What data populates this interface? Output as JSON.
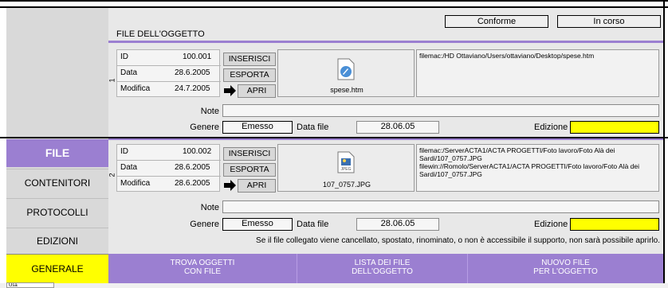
{
  "header": {
    "btn_conforme": "Conforme",
    "btn_in_corso": "In corso",
    "section_title": "FILE DELL'OGGETTO"
  },
  "records": [
    {
      "index": "1",
      "id_label": "ID",
      "id_value": "100.001",
      "data_label": "Data",
      "data_value": "28.6.2005",
      "modifica_label": "Modifica",
      "modifica_value": "24.7.2005",
      "btn_inserisci": "INSERISCI",
      "btn_esporta": "ESPORTA",
      "btn_apri": "APRI",
      "file_name": "spese.htm",
      "path": "filemac:/HD Ottaviano/Users/ottaviano/Desktop/spese.htm",
      "note_label": "Note",
      "note_value": "",
      "genere_label": "Genere",
      "genere_value": "Emesso",
      "data_file_label": "Data file",
      "data_file_value": "28.06.05",
      "edizione_label": "Edizione",
      "edizione_value": ""
    },
    {
      "index": "2",
      "id_label": "ID",
      "id_value": "100.002",
      "data_label": "Data",
      "data_value": "28.6.2005",
      "modifica_label": "Modifica",
      "modifica_value": "28.6.2005",
      "btn_inserisci": "INSERISCI",
      "btn_esporta": "ESPORTA",
      "btn_apri": "APRI",
      "file_name": "107_0757.JPG",
      "thumb_caption": "JPEG",
      "path": "filemac:/ServerACTA1/ACTA PROGETTI/Foto lavoro/Foto Alà dei Sardi/107_0757.JPG\nfilewin://Romolo/ServerACTA1/ACTA PROGETTI/Foto lavoro/Foto Alà dei Sardi/107_0757.JPG",
      "note_label": "Note",
      "note_value": "",
      "genere_label": "Genere",
      "genere_value": "Emesso",
      "data_file_label": "Data file",
      "data_file_value": "28.06.05",
      "edizione_label": "Edizione",
      "edizione_value": ""
    }
  ],
  "sidebar": {
    "items": [
      {
        "label": "FILE"
      },
      {
        "label": "CONTENITORI"
      },
      {
        "label": "PROTOCOLLI"
      },
      {
        "label": "EDIZIONI"
      },
      {
        "label": "GENERALE"
      }
    ]
  },
  "footer": {
    "notice": "Se il file collegato viene cancellato, spostato, rinominato, o non è accessibile il supporto, non sarà possibile aprirlo.",
    "btn1": "TROVA OGGETTI\nCON FILE",
    "btn2": "LISTA DEI FILE\nDELL'OGGETTO",
    "btn3": "NUOVO FILE\nPER L'OGGETTO",
    "status_text": "Usa"
  },
  "colors": {
    "accent_purple": "#9b7fd1",
    "highlight_yellow": "#ffff00",
    "arrow_icon": "#000000"
  }
}
